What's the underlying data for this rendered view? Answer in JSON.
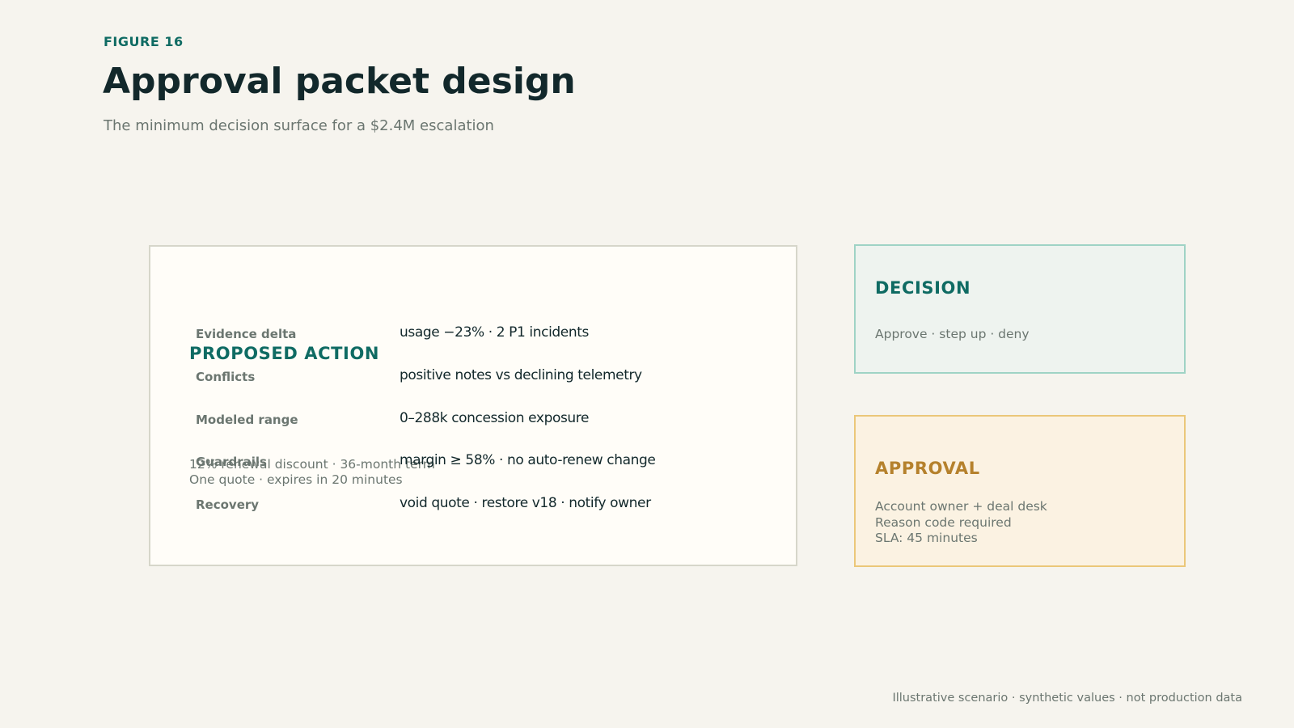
{
  "header": {
    "eyebrow": "FIGURE 16",
    "title": "Approval packet design",
    "subtitle": "The minimum decision surface for a $2.4M escalation"
  },
  "proposal": {
    "heading": "PROPOSED ACTION",
    "lines": [
      "12% renewal discount · 36-month term",
      "One quote · expires in 20 minutes"
    ],
    "evidence": [
      {
        "label": "Evidence delta",
        "value": "usage −23% · 2 P1 incidents"
      },
      {
        "label": "Conflicts",
        "value": "positive notes vs declining telemetry"
      },
      {
        "label": "Modeled range",
        "value": "0–288k concession exposure"
      },
      {
        "label": "Guardrails",
        "value": "margin ≥ 58% · no auto-renew change"
      },
      {
        "label": "Recovery",
        "value": "void quote · restore v18 · notify owner"
      }
    ]
  },
  "decision": {
    "heading": "DECISION",
    "lines": [
      "Approve · step up · deny"
    ]
  },
  "approval": {
    "heading": "APPROVAL",
    "lines": [
      "Account owner + deal desk",
      "Reason code required",
      "SLA: 45 minutes"
    ]
  },
  "footnote": "Illustrative scenario · synthetic values · not production data",
  "colors": {
    "accent_teal": "#0f6b63",
    "accent_amber": "#b5812c",
    "background": "#f6f4ee"
  }
}
